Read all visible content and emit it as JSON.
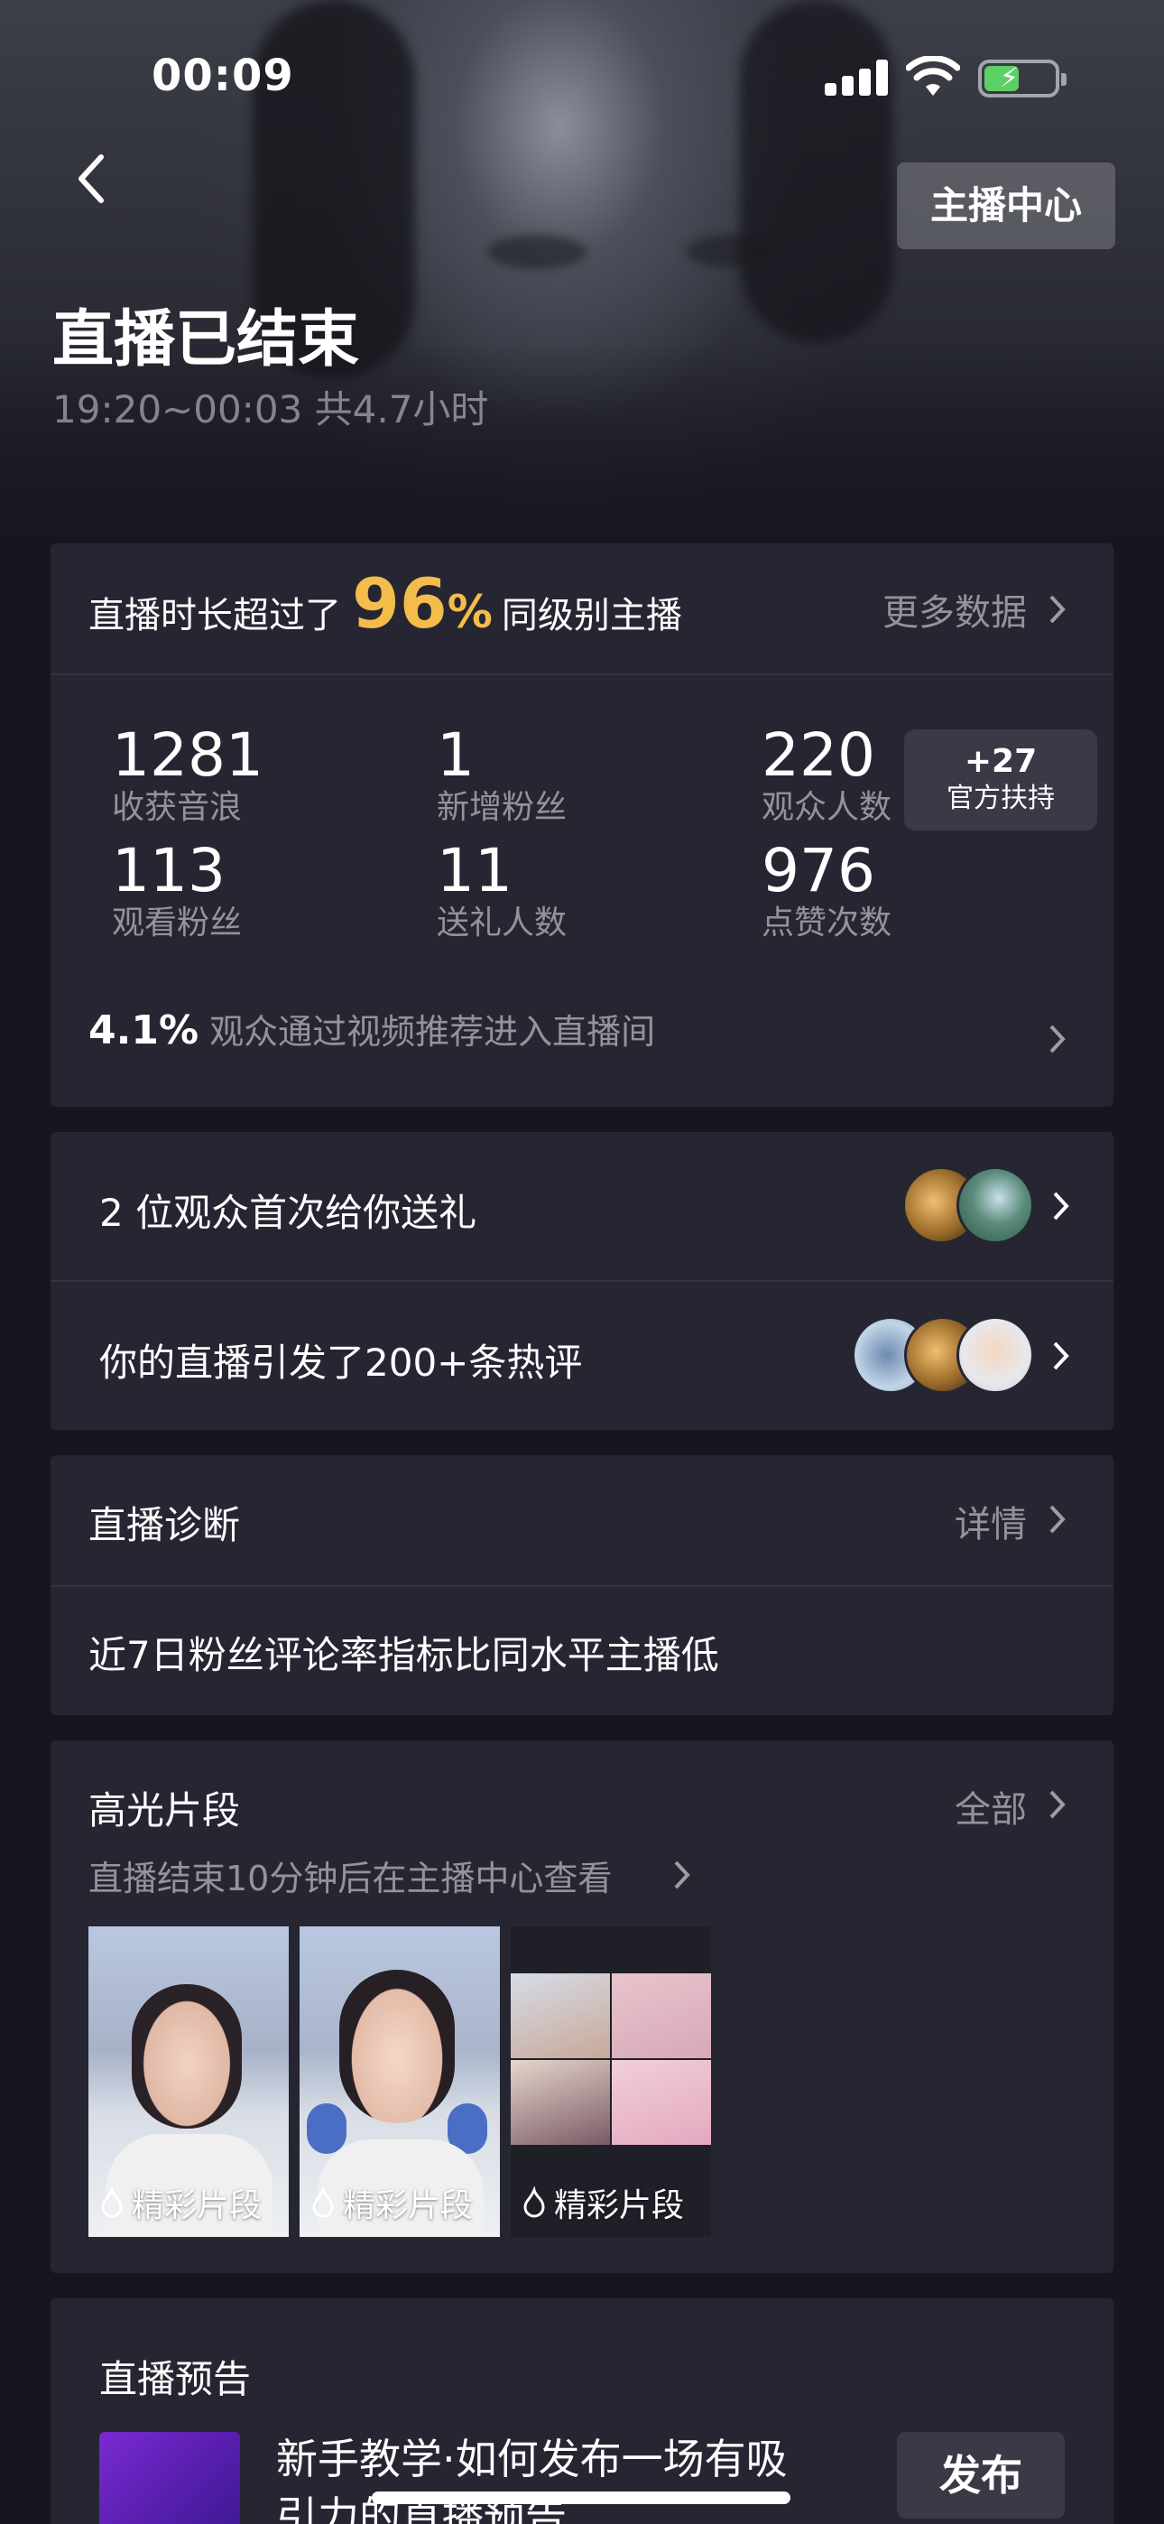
{
  "status_bar": {
    "time": "00:09"
  },
  "header": {
    "anchor_center_label": "主播中心",
    "title": "直播已结束",
    "time_range": "19:20~00:03",
    "duration": "共4.7小时"
  },
  "stats": {
    "rank_prefix": "直播时长超过了",
    "rank_value": "96",
    "rank_unit": "%",
    "rank_suffix": "同级别主播",
    "more_label": "更多数据",
    "metrics": [
      {
        "value": "1281",
        "label": "收获音浪"
      },
      {
        "value": "1",
        "label": "新增粉丝"
      },
      {
        "value": "220",
        "label": "观众人数"
      },
      {
        "value": "113",
        "label": "观看粉丝"
      },
      {
        "value": "11",
        "label": "送礼人数"
      },
      {
        "value": "976",
        "label": "点赞次数"
      }
    ],
    "support_badge": {
      "value": "+27",
      "label": "官方扶持"
    },
    "recommend_pct": "4.1%",
    "recommend_text": "观众通过视频推荐进入直播间"
  },
  "engagement": {
    "gift_row": "2 位观众首次给你送礼",
    "comment_row": "你的直播引发了200+条热评"
  },
  "diagnosis": {
    "title": "直播诊断",
    "detail_label": "详情",
    "message": "近7日粉丝评论率指标比同水平主播低"
  },
  "highlights": {
    "title": "高光片段",
    "all_label": "全部",
    "hint": "直播结束10分钟后在主播中心查看",
    "clips": [
      {
        "label": "精彩片段"
      },
      {
        "label": "精彩片段"
      },
      {
        "label": "精彩片段"
      }
    ]
  },
  "preview": {
    "title": "直播预告",
    "item_text_line1": "新手教学·如何发布一场有吸",
    "item_text_line2": "引力的直播预告",
    "publish_label": "发布"
  }
}
